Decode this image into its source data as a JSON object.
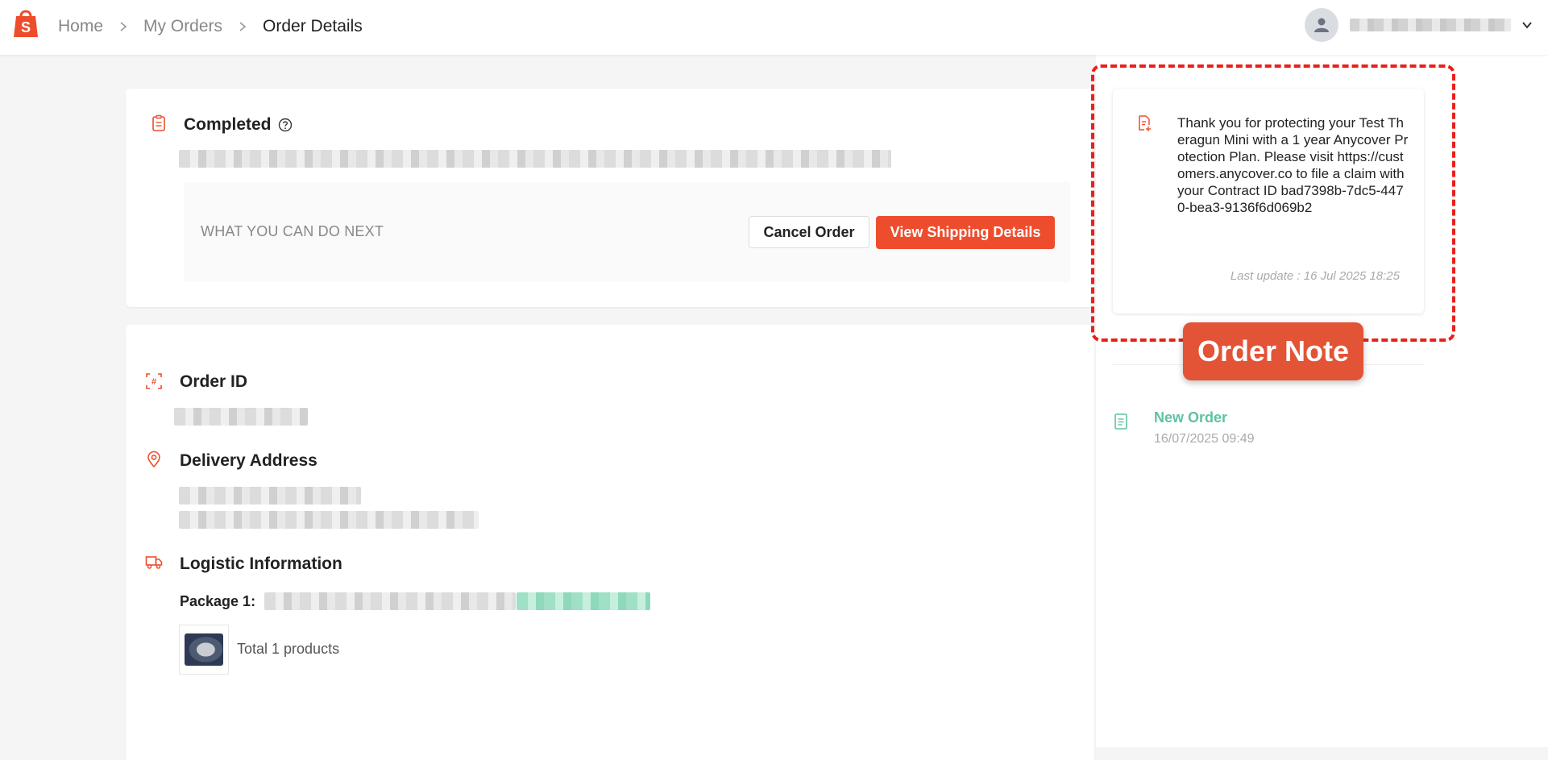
{
  "header": {
    "breadcrumb": {
      "home": "Home",
      "orders": "My Orders",
      "current": "Order Details"
    },
    "icons": {
      "logo": "shopping-bag-logo",
      "avatar": "user-icon",
      "menu": "chevron-down-icon"
    }
  },
  "status": {
    "title": "Completed",
    "next_label": "WHAT YOU CAN DO NEXT",
    "cancel_label": "Cancel Order",
    "shipping_label": "View Shipping Details"
  },
  "details": {
    "order_id_label": "Order ID",
    "delivery_label": "Delivery Address",
    "logistic_label": "Logistic Information",
    "package_label": "Package 1:",
    "total_products": "Total 1 products"
  },
  "note": {
    "text": "Thank you for protecting your Test Theragun Mini with a 1 year Anycover Protection Plan. Please visit https://customers.anycover.co to file a claim with your Contract ID bad7398b-7dc5-4470-bea3-9136f6d069b2",
    "last_update": "Last update : 16 Jul 2025 18:25"
  },
  "annotation": {
    "label": "Order Note"
  },
  "timeline": {
    "title": "New Order",
    "time": "16/07/2025 09:49"
  },
  "colors": {
    "brand": "#ee4d2d",
    "accent_green": "#5ec2a5",
    "annotation_red": "#e8201a"
  }
}
